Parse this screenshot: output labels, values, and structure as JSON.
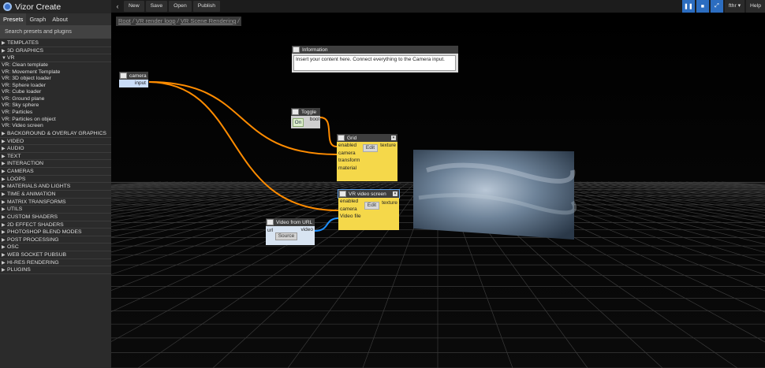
{
  "app": {
    "title": "Vizor Create"
  },
  "tabs": [
    {
      "label": "Presets",
      "active": true
    },
    {
      "label": "Graph",
      "active": false
    },
    {
      "label": "About",
      "active": false
    }
  ],
  "search": {
    "placeholder": "Search presets and plugins"
  },
  "categories": [
    {
      "label": "TEMPLATES"
    },
    {
      "label": "3D GRAPHICS"
    },
    {
      "label": "VR",
      "expanded": true,
      "items": [
        "VR: Clean template",
        "VR: Movement Template",
        "VR: 3D object loader",
        "VR: Sphere loader",
        "VR: Cube loader",
        "VR: Ground plane",
        "VR: Sky sphere",
        "VR: Particles",
        "VR: Particles on object",
        "VR: Video screen"
      ]
    },
    {
      "label": "BACKGROUND & OVERLAY GRAPHICS"
    },
    {
      "label": "VIDEO"
    },
    {
      "label": "AUDIO"
    },
    {
      "label": "TEXT"
    },
    {
      "label": "INTERACTION"
    },
    {
      "label": "CAMERAS"
    },
    {
      "label": "LOOPS"
    },
    {
      "label": "MATERIALS AND LIGHTS"
    },
    {
      "label": "TIME & ANIMATION"
    },
    {
      "label": "MATRIX TRANSFORMS"
    },
    {
      "label": "UTILS"
    },
    {
      "label": "CUSTOM SHADERS"
    },
    {
      "label": "2D EFFECT SHADERS"
    },
    {
      "label": "PHOTOSHOP BLEND MODES"
    },
    {
      "label": "POST PROCESSING"
    },
    {
      "label": "OSC"
    },
    {
      "label": "WEB SOCKET PUBSUB"
    },
    {
      "label": "HI-RES RENDERING"
    },
    {
      "label": "PLUGINS"
    }
  ],
  "toolbar": {
    "back": "‹",
    "new": "New",
    "save": "Save",
    "open": "Open",
    "publish": "Publish"
  },
  "topright": {
    "user": "fthr ▾",
    "help": "Help"
  },
  "breadcrumb": {
    "root": "Root",
    "loop": "VR render loop",
    "scene": "VR Scene Rendering",
    "sep": " / "
  },
  "nodes": {
    "information": {
      "title": "Information",
      "text": "Insert your content here. Connect everything to the Camera input."
    },
    "camera": {
      "title": "camera",
      "port": "input"
    },
    "toggle": {
      "title": "Toggle",
      "button": "On",
      "port": "bool"
    },
    "grid": {
      "title": "Grid",
      "inputs": [
        "enabled",
        "camera",
        "transform",
        "material"
      ],
      "edit": "Edit",
      "output": "texture"
    },
    "vr_video": {
      "title": "VR video screen",
      "inputs": [
        "enabled",
        "camera",
        "Video file"
      ],
      "edit": "Edit",
      "output": "texture"
    },
    "video_url": {
      "title": "Video from URL",
      "input": "url",
      "button": "Source",
      "output": "video"
    }
  },
  "colors": {
    "accent": "#2c6dc0",
    "node_yellow": "#f5d84a",
    "wire_orange": "#ff8c00",
    "wire_blue": "#1e90ff"
  }
}
